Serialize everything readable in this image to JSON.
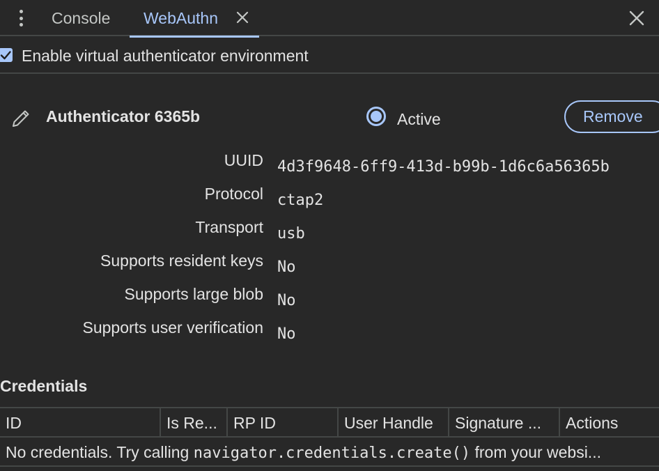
{
  "tabs": [
    {
      "label": "Console",
      "active": false
    },
    {
      "label": "WebAuthn",
      "active": true
    }
  ],
  "icons": {
    "menu": "kebab-menu-icon",
    "tab_close": "close-icon",
    "panel_close": "close-icon",
    "edit": "pencil-icon"
  },
  "colors": {
    "accent": "#a8c7fa",
    "background": "#282828",
    "text": "#e3e3e3",
    "divider": "#444746"
  },
  "enable_checkbox": {
    "label": "Enable virtual authenticator environment",
    "checked": true
  },
  "authenticator": {
    "name": "Authenticator 6365b",
    "active_label": "Active",
    "active": true,
    "remove_label": "Remove",
    "properties": [
      {
        "label": "UUID",
        "value": "4d3f9648-6ff9-413d-b99b-1d6c6a56365b"
      },
      {
        "label": "Protocol",
        "value": "ctap2"
      },
      {
        "label": "Transport",
        "value": "usb"
      },
      {
        "label": "Supports resident keys",
        "value": "No"
      },
      {
        "label": "Supports large blob",
        "value": "No"
      },
      {
        "label": "Supports user verification",
        "value": "No"
      }
    ]
  },
  "credentials": {
    "title": "Credentials",
    "columns": [
      "ID",
      "Is Re...",
      "RP ID",
      "User Handle",
      "Signature ...",
      "Actions"
    ],
    "empty_text_before": "No credentials. Try calling ",
    "empty_text_code": "navigator.credentials.create()",
    "empty_text_after": " from your websi..."
  }
}
